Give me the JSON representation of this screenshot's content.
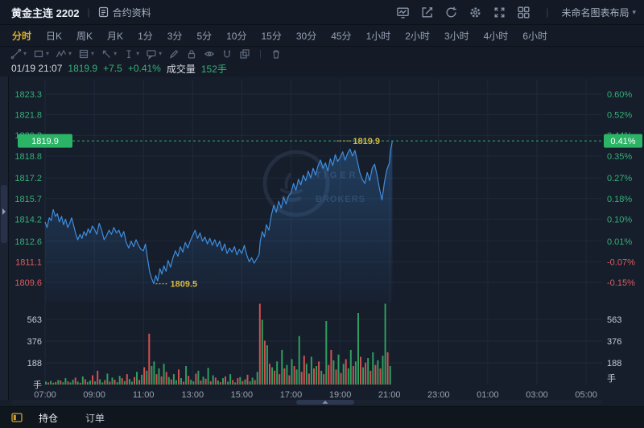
{
  "header": {
    "title": "黄金主连 2202",
    "contract_info_label": "合约资料",
    "layout_name": "未命名图表布局",
    "right_icons": [
      "chart-style-icon",
      "edit-icon",
      "refresh-icon",
      "settings-gear-icon",
      "fullscreen-icon",
      "layout-grid-icon"
    ]
  },
  "timeframes": {
    "active": "分时",
    "items": [
      "分时",
      "日K",
      "周K",
      "月K",
      "1分",
      "3分",
      "5分",
      "10分",
      "15分",
      "30分",
      "45分",
      "1小时",
      "2小时",
      "3小时",
      "4小时",
      "6小时"
    ]
  },
  "draw_toolbar": {
    "tools": [
      "trend-line-tool",
      "rectangle-tool",
      "wave-tool",
      "pattern-tool",
      "arrow-tool",
      "text-tool",
      "callout-tool",
      "brush-tool",
      "lock-tool",
      "visibility-tool",
      "magnet-tool",
      "group-tool",
      "delete-tool"
    ],
    "dropdown_tools": 7
  },
  "info_bar": {
    "datetime": "01/19 21:07",
    "price": "1819.9",
    "change": "+7.5",
    "change_pct": "+0.41%",
    "volume_label": "成交量",
    "volume_value": "152手"
  },
  "bottom_bar": {
    "tabs": [
      "持仓",
      "订单"
    ],
    "active": "持仓"
  },
  "colors": {
    "up": "#35b077",
    "down": "#d95f5f",
    "accent_yellow": "#d8b941",
    "badge_green": "#2bb366",
    "line_blue": "#3e8ede",
    "vol_up": "#2f9e60",
    "vol_down": "#cf5151",
    "axis_gray": "#9aa3b4",
    "vol_label": "#c6ccd8",
    "watermark": "#2f3c52"
  },
  "chart_data": {
    "type": "line",
    "title": "黄金主连 2202 分时",
    "current": {
      "price": 1819.9,
      "price_label": "1819.9",
      "pct_label": "0.41%"
    },
    "y_ticks": [
      {
        "price": "1823.3",
        "pct": "0.60%"
      },
      {
        "price": "1821.8",
        "pct": "0.52%"
      },
      {
        "price": "1820.3",
        "pct": "0.44%"
      },
      {
        "price": "1818.8",
        "pct": "0.35%"
      },
      {
        "price": "1817.2",
        "pct": "0.27%"
      },
      {
        "price": "1815.7",
        "pct": "0.18%"
      },
      {
        "price": "1814.2",
        "pct": "0.10%"
      },
      {
        "price": "1812.6",
        "pct": "0.01%"
      },
      {
        "price": "1811.1",
        "pct": "-0.07%"
      },
      {
        "price": "1809.6",
        "pct": "-0.15%"
      }
    ],
    "x_ticks": [
      "07:00",
      "09:00",
      "11:00",
      "13:00",
      "15:00",
      "17:00",
      "19:00",
      "21:00",
      "23:00",
      "01:00",
      "03:00",
      "05:00"
    ],
    "x_start_hour": 7,
    "hours_per_tick": 2,
    "ylim": [
      1808.2,
      1824.6
    ],
    "volume_ticks": [
      563,
      376,
      188
    ],
    "volume_unit": "手",
    "high_annotation": {
      "text": "1819.9",
      "hour": 19.45,
      "price": 1819.9
    },
    "low_annotation": {
      "text": "1809.5",
      "hour": 11.5,
      "price": 1809.5
    },
    "watermark": {
      "line1": "TIGER",
      "line2": "BROKERS"
    },
    "price_points": [
      [
        7.0,
        1814.0
      ],
      [
        7.08,
        1813.6
      ],
      [
        7.17,
        1814.3
      ],
      [
        7.25,
        1814.1
      ],
      [
        7.33,
        1814.9
      ],
      [
        7.42,
        1814.4
      ],
      [
        7.5,
        1814.6
      ],
      [
        7.58,
        1814.0
      ],
      [
        7.67,
        1814.4
      ],
      [
        7.75,
        1813.8
      ],
      [
        7.83,
        1814.2
      ],
      [
        7.92,
        1813.6
      ],
      [
        8.0,
        1813.9
      ],
      [
        8.08,
        1814.3
      ],
      [
        8.17,
        1813.7
      ],
      [
        8.25,
        1813.1
      ],
      [
        8.33,
        1812.7
      ],
      [
        8.42,
        1813.1
      ],
      [
        8.5,
        1812.8
      ],
      [
        8.58,
        1813.3
      ],
      [
        8.67,
        1813.0
      ],
      [
        8.75,
        1813.5
      ],
      [
        8.83,
        1813.2
      ],
      [
        8.92,
        1813.7
      ],
      [
        9.0,
        1813.5
      ],
      [
        9.1,
        1813.1
      ],
      [
        9.2,
        1813.9
      ],
      [
        9.3,
        1813.4
      ],
      [
        9.4,
        1812.7
      ],
      [
        9.5,
        1813.0
      ],
      [
        9.6,
        1813.4
      ],
      [
        9.7,
        1813.1
      ],
      [
        9.8,
        1813.6
      ],
      [
        9.9,
        1813.2
      ],
      [
        10.0,
        1813.4
      ],
      [
        10.1,
        1812.9
      ],
      [
        10.2,
        1813.3
      ],
      [
        10.3,
        1812.5
      ],
      [
        10.4,
        1812.1
      ],
      [
        10.5,
        1812.6
      ],
      [
        10.6,
        1812.2
      ],
      [
        10.7,
        1812.7
      ],
      [
        10.8,
        1812.3
      ],
      [
        10.9,
        1812.0
      ],
      [
        11.0,
        1811.9
      ],
      [
        11.08,
        1812.4
      ],
      [
        11.17,
        1811.3
      ],
      [
        11.25,
        1810.4
      ],
      [
        11.33,
        1809.9
      ],
      [
        11.42,
        1809.5
      ],
      [
        11.5,
        1810.1
      ],
      [
        11.58,
        1809.7
      ],
      [
        11.67,
        1810.6
      ],
      [
        11.75,
        1810.2
      ],
      [
        11.83,
        1810.8
      ],
      [
        11.92,
        1810.4
      ],
      [
        12.0,
        1811.2
      ],
      [
        12.1,
        1810.7
      ],
      [
        12.2,
        1811.4
      ],
      [
        12.3,
        1811.9
      ],
      [
        12.4,
        1811.5
      ],
      [
        12.5,
        1812.2
      ],
      [
        12.6,
        1811.8
      ],
      [
        12.7,
        1812.5
      ],
      [
        12.8,
        1812.1
      ],
      [
        12.9,
        1812.6
      ],
      [
        13.0,
        1813.0
      ],
      [
        13.1,
        1813.4
      ],
      [
        13.2,
        1812.8
      ],
      [
        13.3,
        1813.2
      ],
      [
        13.4,
        1812.6
      ],
      [
        13.5,
        1812.9
      ],
      [
        13.6,
        1812.4
      ],
      [
        13.7,
        1812.8
      ],
      [
        13.8,
        1812.3
      ],
      [
        13.9,
        1812.7
      ],
      [
        14.0,
        1812.2
      ],
      [
        14.1,
        1812.6
      ],
      [
        14.2,
        1811.9
      ],
      [
        14.3,
        1812.4
      ],
      [
        14.4,
        1811.7
      ],
      [
        14.5,
        1812.1
      ],
      [
        14.6,
        1811.8
      ],
      [
        14.7,
        1812.2
      ],
      [
        14.8,
        1811.6
      ],
      [
        14.9,
        1812.0
      ],
      [
        15.0,
        1811.7
      ],
      [
        15.1,
        1812.3
      ],
      [
        15.2,
        1811.6
      ],
      [
        15.3,
        1811.1
      ],
      [
        15.4,
        1811.4
      ],
      [
        15.5,
        1811.0
      ],
      [
        15.6,
        1811.3
      ],
      [
        15.7,
        1811.6
      ],
      [
        15.75,
        1812.6
      ],
      [
        15.83,
        1813.3
      ],
      [
        15.92,
        1812.9
      ],
      [
        16.0,
        1813.8
      ],
      [
        16.1,
        1813.4
      ],
      [
        16.2,
        1814.5
      ],
      [
        16.3,
        1815.2
      ],
      [
        16.4,
        1814.7
      ],
      [
        16.5,
        1815.5
      ],
      [
        16.6,
        1815.0
      ],
      [
        16.7,
        1815.8
      ],
      [
        16.8,
        1815.3
      ],
      [
        16.9,
        1815.9
      ],
      [
        17.0,
        1816.1
      ],
      [
        17.1,
        1816.8
      ],
      [
        17.2,
        1816.3
      ],
      [
        17.3,
        1817.1
      ],
      [
        17.4,
        1816.7
      ],
      [
        17.5,
        1817.4
      ],
      [
        17.6,
        1817.0
      ],
      [
        17.7,
        1817.7
      ],
      [
        17.8,
        1817.2
      ],
      [
        17.9,
        1817.9
      ],
      [
        18.0,
        1817.4
      ],
      [
        18.1,
        1818.1
      ],
      [
        18.2,
        1818.5
      ],
      [
        18.3,
        1817.9
      ],
      [
        18.4,
        1818.3
      ],
      [
        18.5,
        1817.7
      ],
      [
        18.6,
        1818.6
      ],
      [
        18.7,
        1818.1
      ],
      [
        18.8,
        1818.9
      ],
      [
        18.9,
        1818.4
      ],
      [
        19.0,
        1818.7
      ],
      [
        19.1,
        1819.1
      ],
      [
        19.2,
        1818.5
      ],
      [
        19.3,
        1819.0
      ],
      [
        19.4,
        1819.3
      ],
      [
        19.5,
        1818.8
      ],
      [
        19.6,
        1819.2
      ],
      [
        19.7,
        1818.4
      ],
      [
        19.8,
        1817.6
      ],
      [
        19.9,
        1817.1
      ],
      [
        20.0,
        1816.8
      ],
      [
        20.1,
        1817.6
      ],
      [
        20.2,
        1817.0
      ],
      [
        20.3,
        1817.9
      ],
      [
        20.4,
        1818.2
      ],
      [
        20.5,
        1817.4
      ],
      [
        20.6,
        1816.4
      ],
      [
        20.7,
        1815.6
      ],
      [
        20.8,
        1816.9
      ],
      [
        20.9,
        1817.8
      ],
      [
        21.0,
        1818.3
      ],
      [
        21.05,
        1819.2
      ],
      [
        21.12,
        1819.9
      ]
    ],
    "volume_bars": [
      25,
      -18,
      32,
      15,
      -22,
      40,
      -35,
      20,
      55,
      -28,
      18,
      42,
      -60,
      25,
      -15,
      70,
      -45,
      22,
      35,
      -80,
      28,
      -120,
      45,
      18,
      -38,
      95,
      -25,
      60,
      -42,
      20,
      75,
      -55,
      30,
      -90,
      48,
      25,
      -65,
      110,
      -40,
      85,
      -150,
      120,
      -440,
      160,
      200,
      -90,
      140,
      -70,
      180,
      -110,
      65,
      -45,
      90,
      38,
      -130,
      55,
      -25,
      160,
      -75,
      42,
      28,
      -95,
      120,
      -35,
      68,
      -50,
      145,
      -28,
      80,
      -60,
      35,
      -20,
      55,
      -70,
      25,
      90,
      -40,
      18,
      -55,
      65,
      -30,
      45,
      -85,
      28,
      60,
      -38,
      110,
      -700,
      560,
      -380,
      340,
      -180,
      150,
      -120,
      200,
      -90,
      300,
      -140,
      170,
      -80,
      220,
      -160,
      130,
      420,
      -110,
      -250,
      180,
      -95,
      240,
      -140,
      160,
      -200,
      120,
      -90,
      550,
      -170,
      -300,
      210,
      -130,
      260,
      -100,
      180,
      -220,
      140,
      300,
      -160,
      200,
      620,
      -240,
      150,
      -190,
      230,
      -120,
      280,
      -170,
      210,
      -140,
      250,
      700,
      -280,
      160
    ]
  }
}
